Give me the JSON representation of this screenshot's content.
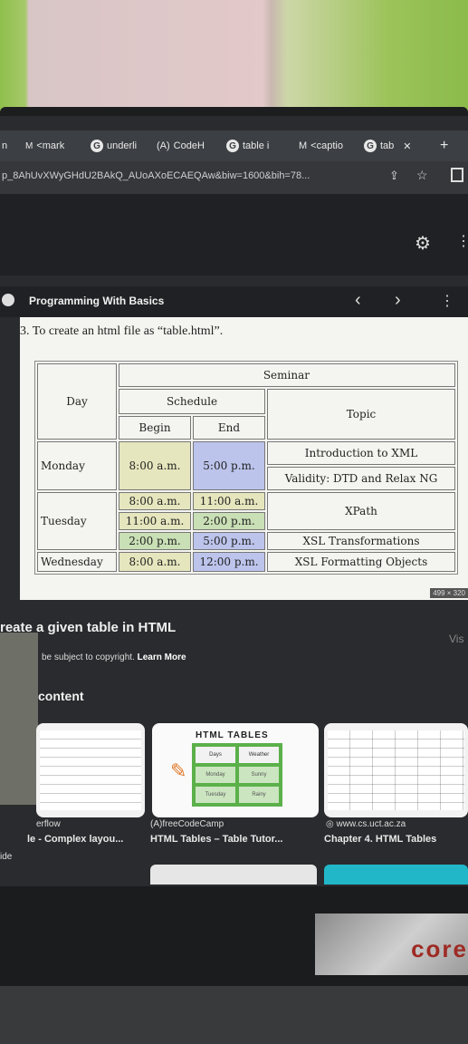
{
  "tabs": [
    "n",
    "<mark",
    "underli",
    "CodeH",
    "table i",
    "<captio",
    "tab"
  ],
  "address": {
    "url": "p_8AhUvXWyGHdU2BAkQ_AUoAXoECAEQAw&biw=1600&bih=78..."
  },
  "header": {
    "site_name": "Programming With Basics"
  },
  "preview": {
    "caption": "3. To create an html file as “table.html”.",
    "table": {
      "seminar": "Seminar",
      "day": "Day",
      "schedule": "Schedule",
      "topic": "Topic",
      "begin": "Begin",
      "end": "End",
      "monday": "Monday",
      "mon_begin": "8:00 a.m.",
      "mon_end": "5:00 p.m.",
      "mon_topic1": "Introduction to XML",
      "mon_topic2": "Validity: DTD and Relax NG",
      "tuesday": "Tuesday",
      "tue_b1": "8:00 a.m.",
      "tue_e1": "11:00 a.m.",
      "tue_b2": "11:00 a.m.",
      "tue_e2": "2:00 p.m.",
      "tue_b3": "2:00 p.m.",
      "tue_e3": "5:00 p.m.",
      "tue_topic1": "XPath",
      "tue_topic2": "XSL Transformations",
      "wednesday": "Wednesday",
      "wed_begin": "8:00 a.m.",
      "wed_end": "12:00 p.m.",
      "wed_topic": "XSL Formatting Objects"
    },
    "dimensions": "499 × 320"
  },
  "image_title": "reate a given table in HTML",
  "copyright": {
    "text": "be subject to copyright.",
    "learn_more": "Learn More"
  },
  "related_label": "content",
  "results": [
    {
      "source": "erflow",
      "title": "le - Complex layou..."
    },
    {
      "source": "freeCodeCamp",
      "title": "HTML Tables – Table Tutor...",
      "card_heading": "HTML TABLES",
      "cells": [
        "Days",
        "Weather",
        "Monday",
        "Sunny",
        "Tuesday",
        "Rainy"
      ]
    },
    {
      "source": "www.cs.uct.ac.za",
      "title": "Chapter 4. HTML Tables"
    }
  ],
  "side_label": "ide",
  "visit_label": "Vis",
  "sticker_text": "core"
}
